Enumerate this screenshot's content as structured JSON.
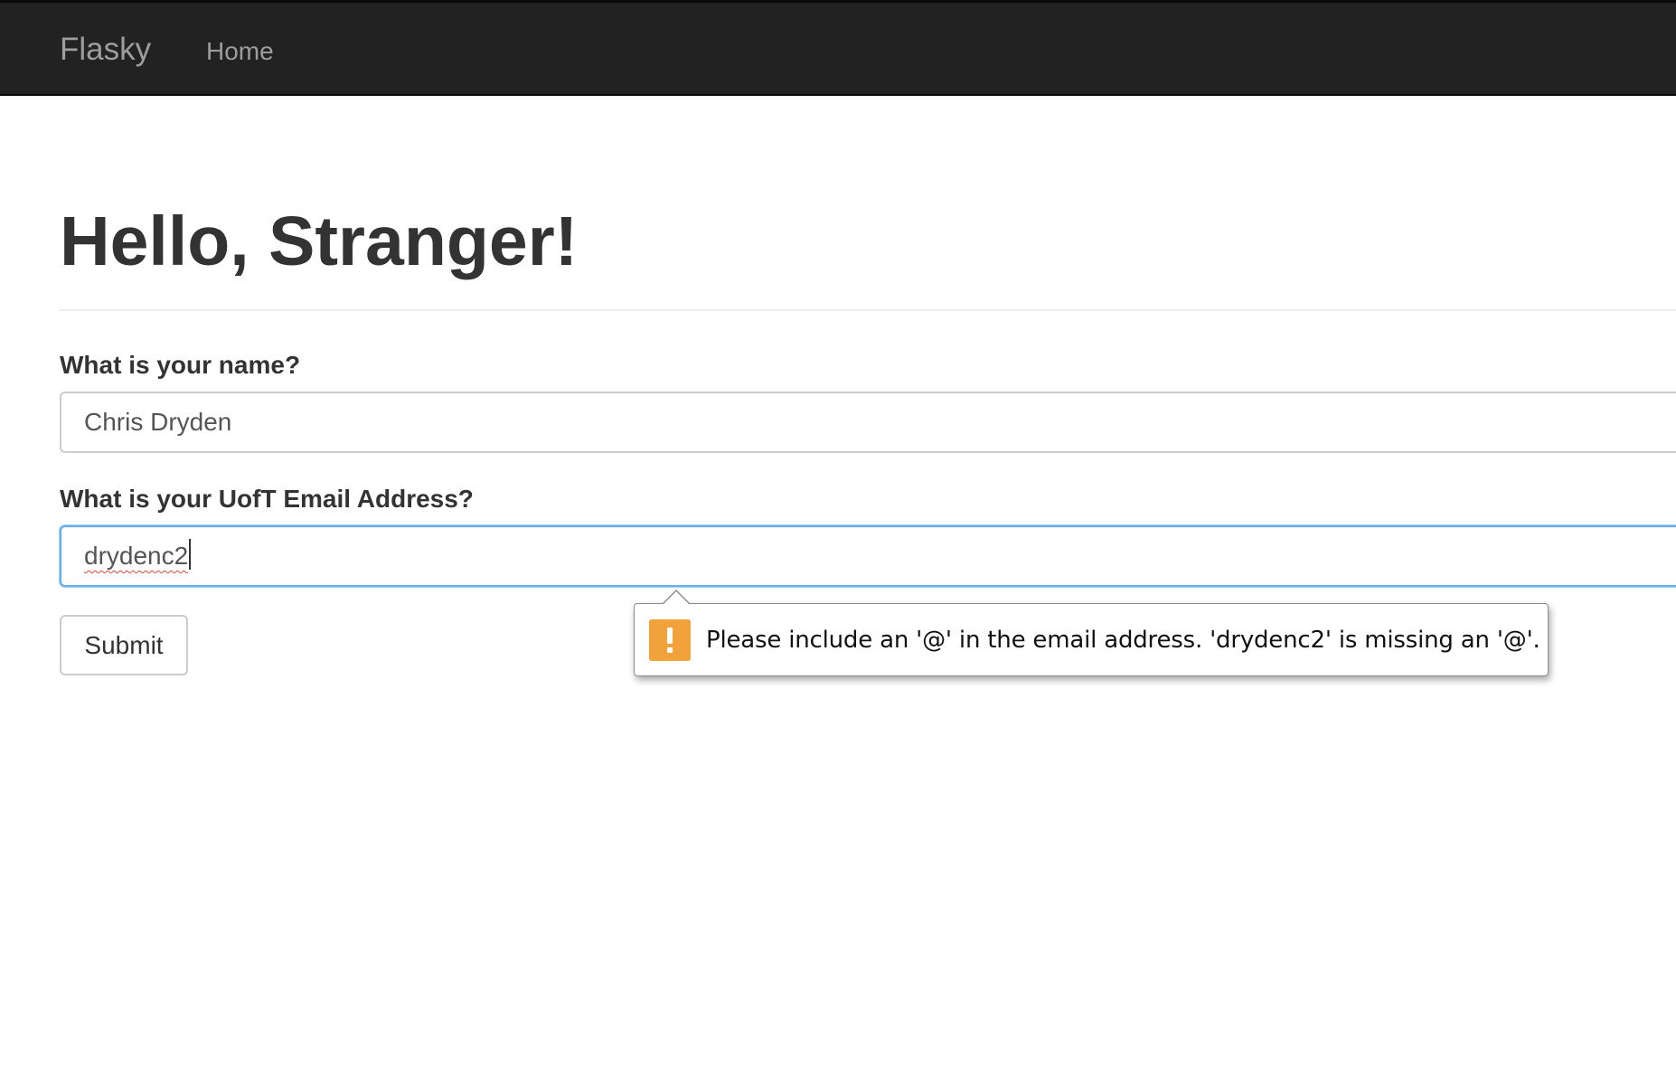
{
  "navbar": {
    "brand": "Flasky",
    "links": [
      {
        "label": "Home"
      }
    ]
  },
  "page": {
    "title": "Hello, Stranger!"
  },
  "form": {
    "name_label": "What is your name?",
    "name_value": "Chris Dryden",
    "email_label": "What is your UofT Email Address?",
    "email_value": "drydenc2",
    "submit_label": "Submit"
  },
  "validation_tooltip": {
    "icon": "warning-icon",
    "message": "Please include an '@' in the email address. 'drydenc2' is missing an '@'.",
    "accent_color": "#f2a23b"
  },
  "colors": {
    "navbar_bg": "#222222",
    "navbar_text": "#9d9d9d",
    "focus_border": "#66afe9",
    "text": "#333333"
  }
}
